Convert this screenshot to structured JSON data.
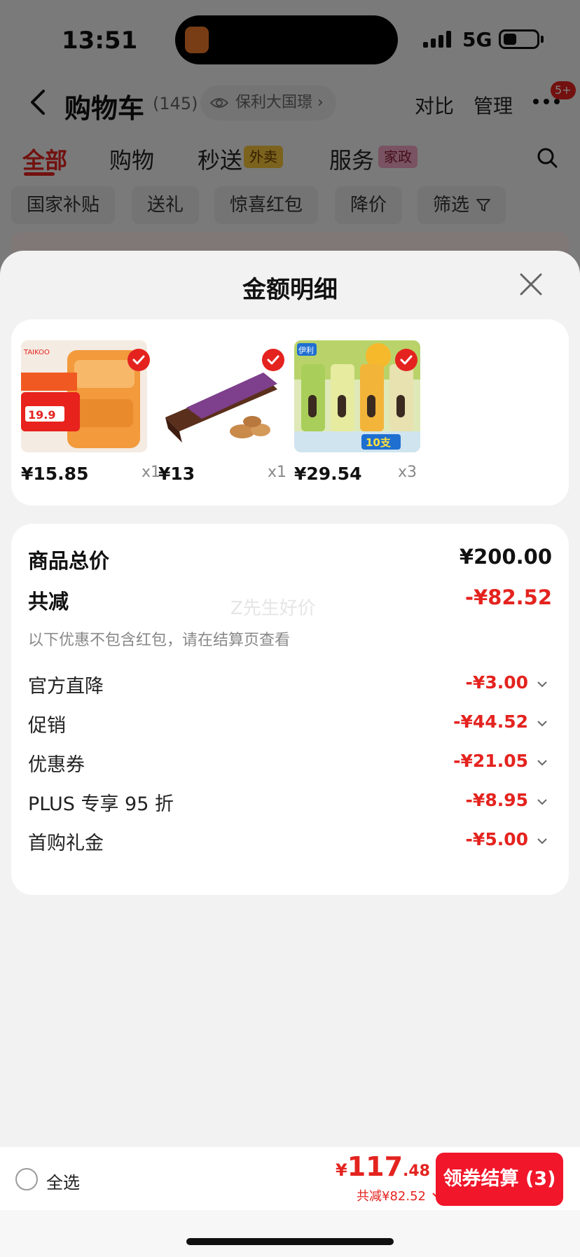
{
  "status_bar": {
    "time": "13:51",
    "network": "5G"
  },
  "header": {
    "title": "购物车",
    "count": "(145)",
    "address": "保利大国璟",
    "actions": [
      "对比",
      "管理"
    ],
    "badge": "5+"
  },
  "tabs": [
    {
      "label": "全部"
    },
    {
      "label": "购物"
    },
    {
      "label": "秒送",
      "tag": "外卖"
    },
    {
      "label": "服务",
      "tag": "家政"
    }
  ],
  "filters": [
    "国家补贴",
    "送礼",
    "惊喜红包",
    "降价",
    "筛选"
  ],
  "sheet": {
    "title": "金额明细",
    "products": [
      {
        "price": "¥15.85",
        "qty": "x1",
        "image_icon": "bread-product-icon",
        "brand": "TAIKOO",
        "promo": "19.9"
      },
      {
        "price": "¥13",
        "qty": "x1",
        "image_icon": "chocolate-product-icon"
      },
      {
        "price": "¥29.54",
        "qty": "x3",
        "image_icon": "ice-cream-product-icon",
        "brand": "伊利",
        "promo": "10支"
      }
    ],
    "summary": {
      "total_label": "商品总价",
      "total_value": "¥200.00",
      "discount_label": "共减",
      "discount_value": "-¥82.52",
      "note": "以下优惠不包含红包，请在结算页查看",
      "watermark": "Z先生好价",
      "rows": [
        {
          "label": "官方直降",
          "value": "-¥3.00"
        },
        {
          "label": "促销",
          "value": "-¥44.52"
        },
        {
          "label": "优惠券",
          "value": "-¥21.05"
        },
        {
          "label": "PLUS 专享 95 折",
          "value": "-¥8.95"
        },
        {
          "label": "首购礼金",
          "value": "-¥5.00"
        }
      ]
    }
  },
  "bottom_bar": {
    "select_all": "全选",
    "currency": "¥",
    "total_int": "117",
    "total_dec": ".48",
    "discount": "共减¥82.52",
    "checkout": "领券结算 (3)"
  },
  "colors": {
    "accent": "#e4231f",
    "checkout": "#f1162a",
    "sheet_bg": "#f2f2f2"
  }
}
